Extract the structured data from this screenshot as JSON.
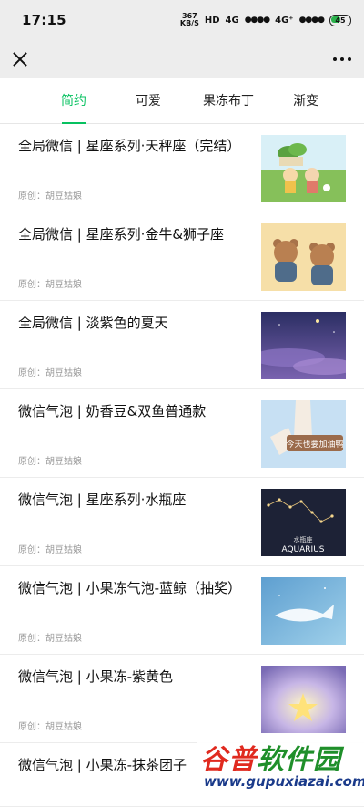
{
  "status": {
    "time": "17:15",
    "net_speed_value": "367",
    "net_speed_unit": "KB/S",
    "hd": "HD",
    "net1": "4G",
    "net2": "4G⁺",
    "battery": "45"
  },
  "tabs": [
    {
      "label": "简约",
      "active": true
    },
    {
      "label": "可爱",
      "active": false
    },
    {
      "label": "果冻布丁",
      "active": false
    },
    {
      "label": "渐变",
      "active": false
    }
  ],
  "articles": [
    {
      "title": "全局微信 | 星座系列·天秤座（完结）",
      "author": "原创：胡豆姑娘",
      "thumb": "cartoon-field-thumbnail"
    },
    {
      "title": "全局微信 | 星座系列·金牛&狮子座",
      "author": "原创：胡豆姑娘",
      "thumb": "bears-thumbnail"
    },
    {
      "title": "全局微信 | 淡紫色的夏天",
      "author": "原创：胡豆姑娘",
      "thumb": "purple-sky-thumbnail"
    },
    {
      "title": "微信气泡 | 奶香豆&双鱼普通款",
      "author": "原创：胡豆姑娘",
      "thumb": "hand-sign-thumbnail",
      "thumb_text": "今天也要加油鸭"
    },
    {
      "title": "微信气泡 | 星座系列·水瓶座",
      "author": "原创：胡豆姑娘",
      "thumb": "constellation-thumbnail",
      "thumb_text_cn": "水瓶座",
      "thumb_text_en": "AQUARIUS"
    },
    {
      "title": "微信气泡 | 小果冻气泡-蓝鲸（抽奖）",
      "author": "原创：胡豆姑娘",
      "thumb": "whale-thumbnail"
    },
    {
      "title": "微信气泡 | 小果冻-紫黄色",
      "author": "原创：胡豆姑娘",
      "thumb": "star-thumbnail"
    },
    {
      "title": "微信气泡 | 小果冻-抹茶团子",
      "author": "",
      "thumb": ""
    }
  ],
  "watermark": {
    "title_a": "谷普",
    "title_b": "软件园",
    "url": "www.gupuxiazai.com"
  },
  "colors": {
    "accent": "#07c160",
    "background": "#ededed"
  }
}
